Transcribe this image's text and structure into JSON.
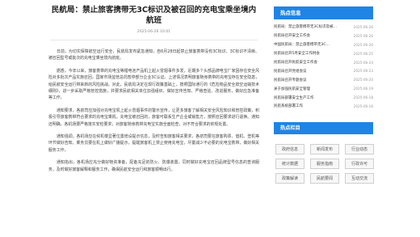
{
  "article": {
    "title": "民航局：禁止旅客携带无3C标识及被召回的充电宝乘坐境内航班",
    "meta": "2025-06-26 10:01",
    "paragraphs": [
      "日前，为切实保障航空运行安全，民航局发布紧急通知，自6月28日起禁止旅客携带没有3C标识、3C标识不清晰、被召回型号或批次的充电宝乘坐境内航班。",
      "据悉，今年以来，旅客携带的充电宝等锂电池产品机上起火冒烟事件多发，近期多个头部品牌电宝厂家因存在安全风险对多批次产品实施召回，国家市场监管总局暂停部分企业3C认证。上述情况表明旅客随身携带的充电宝存在安全隐患，给民航安全运行带来新的风险挑战。对此，民航局决定在现行政策基础上，按照国际通行的《危险物品安全航空运输技术细则》，进一步采取严格管控措施，并要求民航相关单位加强组织、做好宣传告知、严格查验、改进服务，做好应急准备等工作。",
      "通知要求，各航司应加强对充电宝机上起火冒烟事件的警示宣传，让更多旅客了解相关安全风险知识和管控政策，积极引导旅客携带符合要求的充电宝乘机。充电宝被召回的，旅客可联系生产企业或销售方，按照召回要求进行退换。通知还明确，各机场要严格落实安检要求，对旅客随身携带充电宝实施全面检查，对不符合要求的依规处置。",
      "通知强调，各机场应在候机楼显著位置增设提示信息，及时告知旅客相关要求，各航司要在旅客购票、值机、登机等环节做好告知，乘务员要在机上做好广播提示，提醒旅客机上禁止使用充电宝，尽量减少不必要的充电宝携带，做好相关服务工作。",
      "通知指出，各机场应充分做好物资准备，配备充足的防火、防爆装置。同时做好充电宝召回品牌型号信息的查询服务，及时做好旅客解释和服务工作，确保民航安全运行和旅客顺畅出行。"
    ]
  },
  "sidebar": {
    "news_head": "热点信息",
    "news": [
      {
        "title": "民航局：禁止旅客携带无3C标识及被…",
        "date": "2025-06-26"
      },
      {
        "title": "民航局召开安全工作会",
        "date": "2025-06-26"
      },
      {
        "title": "中国民航局：禁止旅客携带无3C…",
        "date": "2025-06-26"
      },
      {
        "title": "民航局召开5月安全工作例会",
        "date": "2025-06-25"
      },
      {
        "title": "民航局召开民航安全工作会",
        "date": "2025-06-24"
      },
      {
        "title": "民航局召开党组会议",
        "date": "2025-06-23"
      },
      {
        "title": "民航局召开专题会议",
        "date": "2025-06-20"
      },
      {
        "title": "关于加强民航安全管理",
        "date": "2025-06-19"
      },
      {
        "title": "民航局部署安全生产工作",
        "date": "2025-06-18"
      },
      {
        "title": "民航系统部署工作",
        "date": "2025-06-16"
      }
    ],
    "hot_head": "热点栏目",
    "hot": [
      "政府信息",
      "新闻发布",
      "行业动态",
      "统计数据",
      "服务指南",
      "行政许可",
      "政策解读",
      "民航要闻",
      "互动交流"
    ]
  }
}
